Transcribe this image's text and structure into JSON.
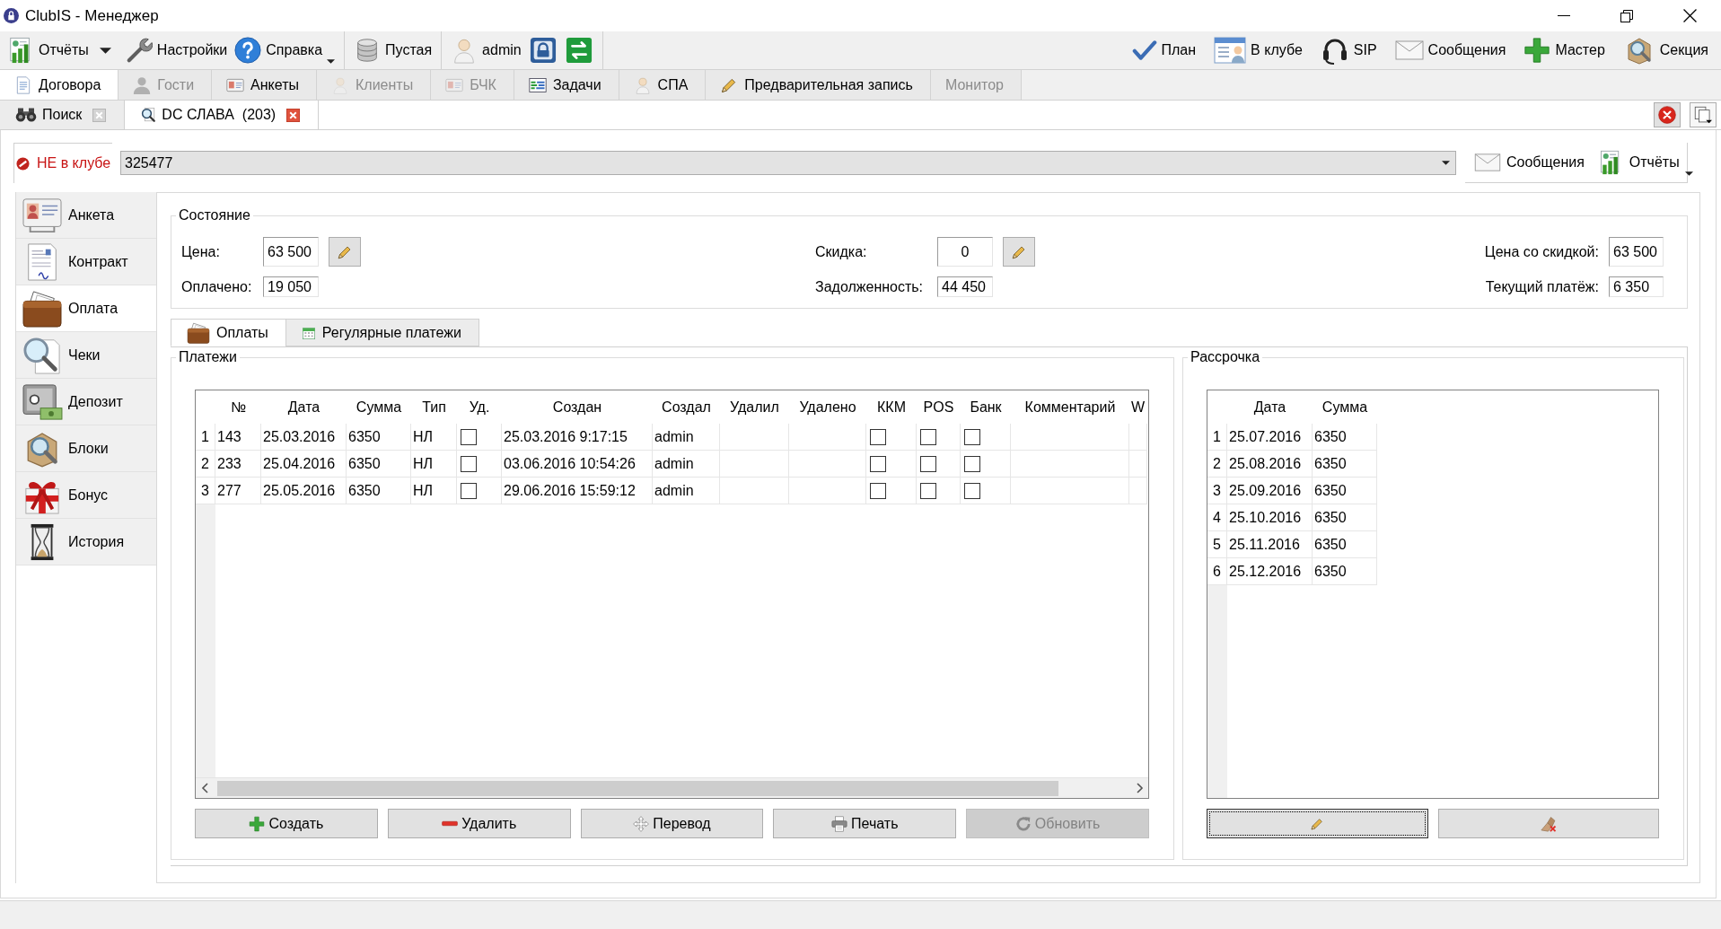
{
  "window": {
    "title": "ClubIS - Менеджер"
  },
  "toolbar": {
    "groups": [
      {
        "items": [
          {
            "label": "Отчёты",
            "kind": "split"
          },
          {
            "label": "Настройки",
            "kind": "plain"
          },
          {
            "label": "Справка",
            "kind": "dropdown"
          }
        ]
      },
      {
        "items": [
          {
            "label": "Пустая",
            "kind": "plain"
          }
        ]
      },
      {
        "items": [
          {
            "label": "admin",
            "kind": "plain"
          }
        ]
      }
    ],
    "right": [
      {
        "label": "План"
      },
      {
        "label": "В клубе"
      },
      {
        "label": "SIP"
      },
      {
        "label": "Сообщения"
      },
      {
        "label": "Мастер"
      },
      {
        "label": "Секция"
      }
    ]
  },
  "module_tabs": [
    {
      "label": "Договора",
      "selected": true,
      "disabled": false
    },
    {
      "label": "Гости",
      "selected": false,
      "disabled": true
    },
    {
      "label": "Анкеты",
      "selected": false,
      "disabled": false
    },
    {
      "label": "Клиенты",
      "selected": false,
      "disabled": true
    },
    {
      "label": "БЧК",
      "selected": false,
      "disabled": true
    },
    {
      "label": "Задачи",
      "selected": false,
      "disabled": false
    },
    {
      "label": "СПА",
      "selected": false,
      "disabled": false
    },
    {
      "label": "Предварительная запись",
      "selected": false,
      "disabled": false
    },
    {
      "label": "Монитор",
      "selected": false,
      "disabled": true
    }
  ],
  "document_tabs": [
    {
      "label": "Поиск",
      "selected": false
    },
    {
      "label": "DC СЛАВА  (203)",
      "selected": true
    }
  ],
  "client": {
    "status": "НЕ в клубе",
    "in_club": false,
    "card": "325477",
    "buttons": [
      {
        "label": "Сообщения",
        "kind": "plain"
      },
      {
        "label": "Отчёты",
        "kind": "dropdown"
      }
    ]
  },
  "sidebar": {
    "items": [
      {
        "label": "Анкета",
        "selected": false
      },
      {
        "label": "Контракт",
        "selected": false
      },
      {
        "label": "Оплата",
        "selected": true
      },
      {
        "label": "Чеки",
        "selected": false
      },
      {
        "label": "Депозит",
        "selected": false
      },
      {
        "label": "Блоки",
        "selected": false
      },
      {
        "label": "Бонус",
        "selected": false
      },
      {
        "label": "История",
        "selected": false
      }
    ]
  },
  "state": {
    "title": "Состояние",
    "columns": [
      {
        "fields": [
          {
            "label": "Цена:",
            "value": "63 500",
            "editable": true
          },
          {
            "label": "Оплачено:",
            "value": "19 050",
            "editable": false
          }
        ]
      },
      {
        "fields": [
          {
            "label": "Скидка:",
            "value": "0",
            "editable": true
          },
          {
            "label": "Задолженность:",
            "value": "44 450",
            "editable": false
          }
        ]
      },
      {
        "fields": [
          {
            "label": "Цена со скидкой:",
            "value": "63 500",
            "editable": false
          },
          {
            "label": "Текущий платёж:",
            "value": "6 350",
            "editable": false
          }
        ]
      }
    ]
  },
  "payment_tabs": [
    {
      "label": "Оплаты",
      "selected": true
    },
    {
      "label": "Регулярные платежи",
      "selected": false
    }
  ],
  "payments": {
    "title": "Платежи",
    "columns": [
      "№",
      "Дата",
      "Сумма",
      "Тип",
      "Уд.",
      "Создан",
      "Создал",
      "Удалил",
      "Удалено",
      "ККМ",
      "POS",
      "Банк",
      "Комментарий",
      "W"
    ],
    "rows": [
      {
        "index": "1",
        "no": "143",
        "date": "25.03.2016",
        "sum": "6350",
        "type": "НЛ",
        "deleted": false,
        "created": "25.03.2016 9:17:15",
        "created_by": "admin",
        "kkm": false,
        "pos": false,
        "bank": false
      },
      {
        "index": "2",
        "no": "233",
        "date": "25.04.2016",
        "sum": "6350",
        "type": "НЛ",
        "deleted": false,
        "created": "03.06.2016 10:54:26",
        "created_by": "admin",
        "kkm": false,
        "pos": false,
        "bank": false
      },
      {
        "index": "3",
        "no": "277",
        "date": "25.05.2016",
        "sum": "6350",
        "type": "НЛ",
        "deleted": false,
        "created": "29.06.2016 15:59:12",
        "created_by": "admin",
        "kkm": false,
        "pos": false,
        "bank": false
      }
    ],
    "buttons": [
      {
        "label": "Создать",
        "disabled": false
      },
      {
        "label": "Удалить",
        "disabled": false
      },
      {
        "label": "Перевод",
        "disabled": false
      },
      {
        "label": "Печать",
        "disabled": false
      },
      {
        "label": "Обновить",
        "disabled": true
      }
    ]
  },
  "installments": {
    "title": "Рассрочка",
    "columns": [
      "Дата",
      "Сумма"
    ],
    "rows": [
      {
        "index": "1",
        "date": "25.07.2016",
        "sum": "6350"
      },
      {
        "index": "2",
        "date": "25.08.2016",
        "sum": "6350"
      },
      {
        "index": "3",
        "date": "25.09.2016",
        "sum": "6350"
      },
      {
        "index": "4",
        "date": "25.10.2016",
        "sum": "6350"
      },
      {
        "index": "5",
        "date": "25.11.2016",
        "sum": "6350"
      },
      {
        "index": "6",
        "date": "25.12.2016",
        "sum": "6350"
      }
    ],
    "actions": [
      {
        "focused": true
      },
      {
        "focused": false
      }
    ]
  }
}
